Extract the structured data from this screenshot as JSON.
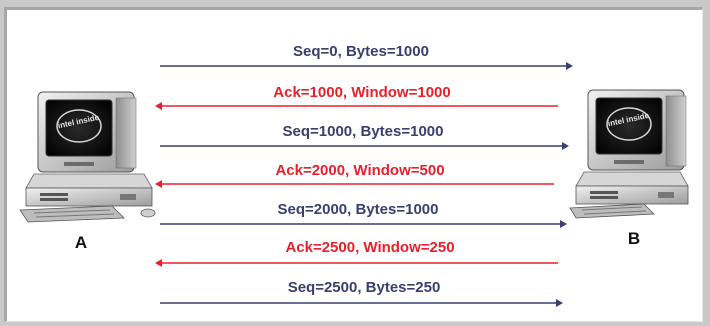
{
  "colors": {
    "data": "#3a3f6e",
    "ack": "#e8202a",
    "frame": "#a7a7a7"
  },
  "hosts": {
    "left": {
      "label": "A",
      "icon": "desktop-computer-icon",
      "screen_logo": "intel inside"
    },
    "right": {
      "label": "B",
      "icon": "desktop-computer-icon",
      "screen_logo": "intel inside"
    }
  },
  "messages": [
    {
      "text": "Seq=0, Bytes=1000",
      "direction": "A-to-B",
      "kind": "data"
    },
    {
      "text": "Ack=1000, Window=1000",
      "direction": "B-to-A",
      "kind": "ack"
    },
    {
      "text": "Seq=1000, Bytes=1000",
      "direction": "A-to-B",
      "kind": "data"
    },
    {
      "text": "Ack=2000, Window=500",
      "direction": "B-to-A",
      "kind": "ack"
    },
    {
      "text": "Seq=2000, Bytes=1000",
      "direction": "A-to-B",
      "kind": "data"
    },
    {
      "text": "Ack=2500, Window=250",
      "direction": "B-to-A",
      "kind": "ack"
    },
    {
      "text": "Seq=2500, Bytes=250",
      "direction": "A-to-B",
      "kind": "data"
    }
  ]
}
